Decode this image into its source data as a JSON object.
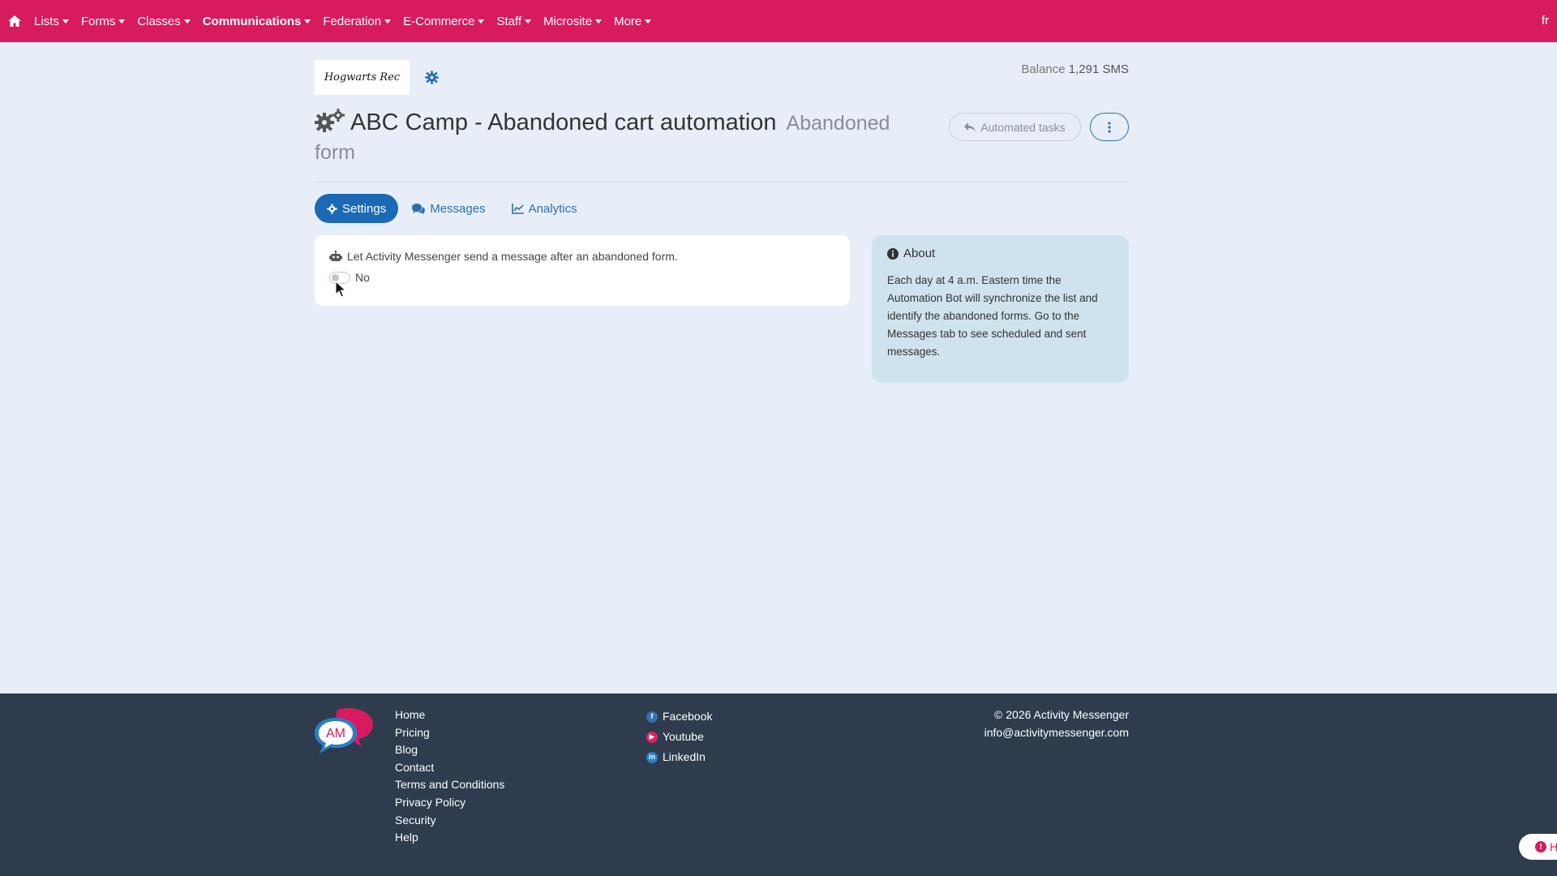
{
  "nav": {
    "items": [
      {
        "label": "Lists"
      },
      {
        "label": "Forms"
      },
      {
        "label": "Classes"
      },
      {
        "label": "Communications",
        "active": true
      },
      {
        "label": "Federation"
      },
      {
        "label": "E-Commerce"
      },
      {
        "label": "Staff"
      },
      {
        "label": "Microsite"
      },
      {
        "label": "More"
      }
    ],
    "lang": "fr"
  },
  "header": {
    "org_logo_text": "Hogwarts Rec",
    "balance_label": "Balance",
    "balance_value": "1,291 SMS",
    "title": "ABC Camp - Abandoned cart automation",
    "subtitle": "Abandoned form",
    "automated_tasks_label": "Automated tasks"
  },
  "tabs": [
    {
      "label": "Settings",
      "active": true
    },
    {
      "label": "Messages"
    },
    {
      "label": "Analytics"
    }
  ],
  "settings": {
    "description": "Let Activity Messenger send a message after an abandoned form.",
    "toggle_label": "No",
    "toggle_on": false
  },
  "about": {
    "title": "About",
    "text": "Each day at 4 a.m. Eastern time the Automation Bot will synchronize the list and identify the abandoned forms. Go to the Messages tab to see scheduled and sent messages."
  },
  "footer": {
    "links": [
      "Home",
      "Pricing",
      "Blog",
      "Contact",
      "Terms and Conditions",
      "Privacy Policy",
      "Security",
      "Help"
    ],
    "social": [
      {
        "label": "Facebook",
        "icon": "facebook-icon",
        "color": "#3b6fb5"
      },
      {
        "label": "Youtube",
        "icon": "youtube-icon",
        "color": "#e0245e"
      },
      {
        "label": "LinkedIn",
        "icon": "linkedin-icon",
        "color": "#2a80c4"
      }
    ],
    "copyright": "© 2026 Activity Messenger",
    "email": "info@activitymessenger.com",
    "logo_text": "AM"
  },
  "help_widget": {
    "label": "H"
  },
  "colors": {
    "brand": "#d81b5e",
    "primary": "#1c6ab5",
    "footer": "#2e3c4d",
    "about_bg": "#cfe3ef"
  }
}
